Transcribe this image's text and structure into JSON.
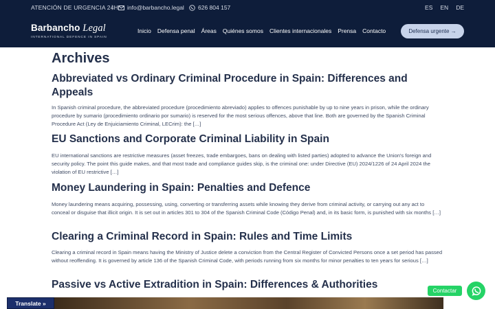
{
  "topbar": {
    "urgent_label": "ATENCIÓN DE URGENCIA 24H",
    "separator": "|",
    "email": "info@barbancho.legal",
    "phone": "626 804 157",
    "languages": [
      "ES",
      "EN",
      "DE"
    ]
  },
  "brand": {
    "name_main": "Barbancho",
    "name_italic": "Legal",
    "tagline": "INTERNATIONAL DEFENCE IN SPAIN"
  },
  "nav": {
    "items": [
      "Inicio",
      "Defensa penal",
      "Áreas",
      "Quiénes somos",
      "Clientes internacionales",
      "Prensa",
      "Contacto"
    ],
    "cta_label": "Defensa urgente →"
  },
  "page": {
    "title": "Archives"
  },
  "posts": [
    {
      "title": "Abbreviated vs Ordinary Criminal Procedure in Spain: Differences and Appeals",
      "excerpt": "In Spanish criminal procedure, the abbreviated procedure (procedimiento abreviado) applies to offences punishable by up to nine years in prison, while the ordinary procedure by sumario (procedimiento ordinario por sumario) is reserved for the most serious offences, above that line. Both are governed by the Spanish Criminal Procedure Act (Ley de Enjuiciamiento Criminal, LECrim): the […]"
    },
    {
      "title": "EU Sanctions and Corporate Criminal Liability in Spain",
      "excerpt": "EU international sanctions are restrictive measures (asset freezes, trade embargoes, bans on dealing with listed parties) adopted to advance the Union's foreign and security policy. The point this guide makes, and that most trade and compliance guides skip, is the criminal one: under Directive (EU) 2024/1226 of 24 April 2024 the violation of EU restrictive […]"
    },
    {
      "title": "Money Laundering in Spain: Penalties and Defence",
      "excerpt": "Money laundering means acquiring, possessing, using, converting or transferring assets while knowing they derive from criminal activity, or carrying out any act to conceal or disguise that illicit origin. It is set out in articles 301 to 304 of the Spanish Criminal Code (Código Penal) and, in its basic form, is punished with six months […]"
    },
    {
      "title": "Clearing a Criminal Record in Spain: Rules and Time Limits",
      "excerpt": "Clearing a criminal record in Spain means having the Ministry of Justice delete a conviction from the Central Register of Convicted Persons once a set period has passed without reoffending. It is governed by article 136 of the Spanish Criminal Code, with periods running from six months for minor penalties to ten years for serious […]"
    },
    {
      "title": "Passive vs Active Extradition in Spain: Differences & Authorities",
      "excerpt": ""
    }
  ],
  "widgets": {
    "translate_label": "Translate »",
    "contact_label": "Contactar"
  },
  "colors": {
    "header_bg": "#0e1d3a",
    "cta_bg": "#c7d3ea",
    "whatsapp": "#25d366",
    "translate_bg": "#1c2f6b"
  }
}
